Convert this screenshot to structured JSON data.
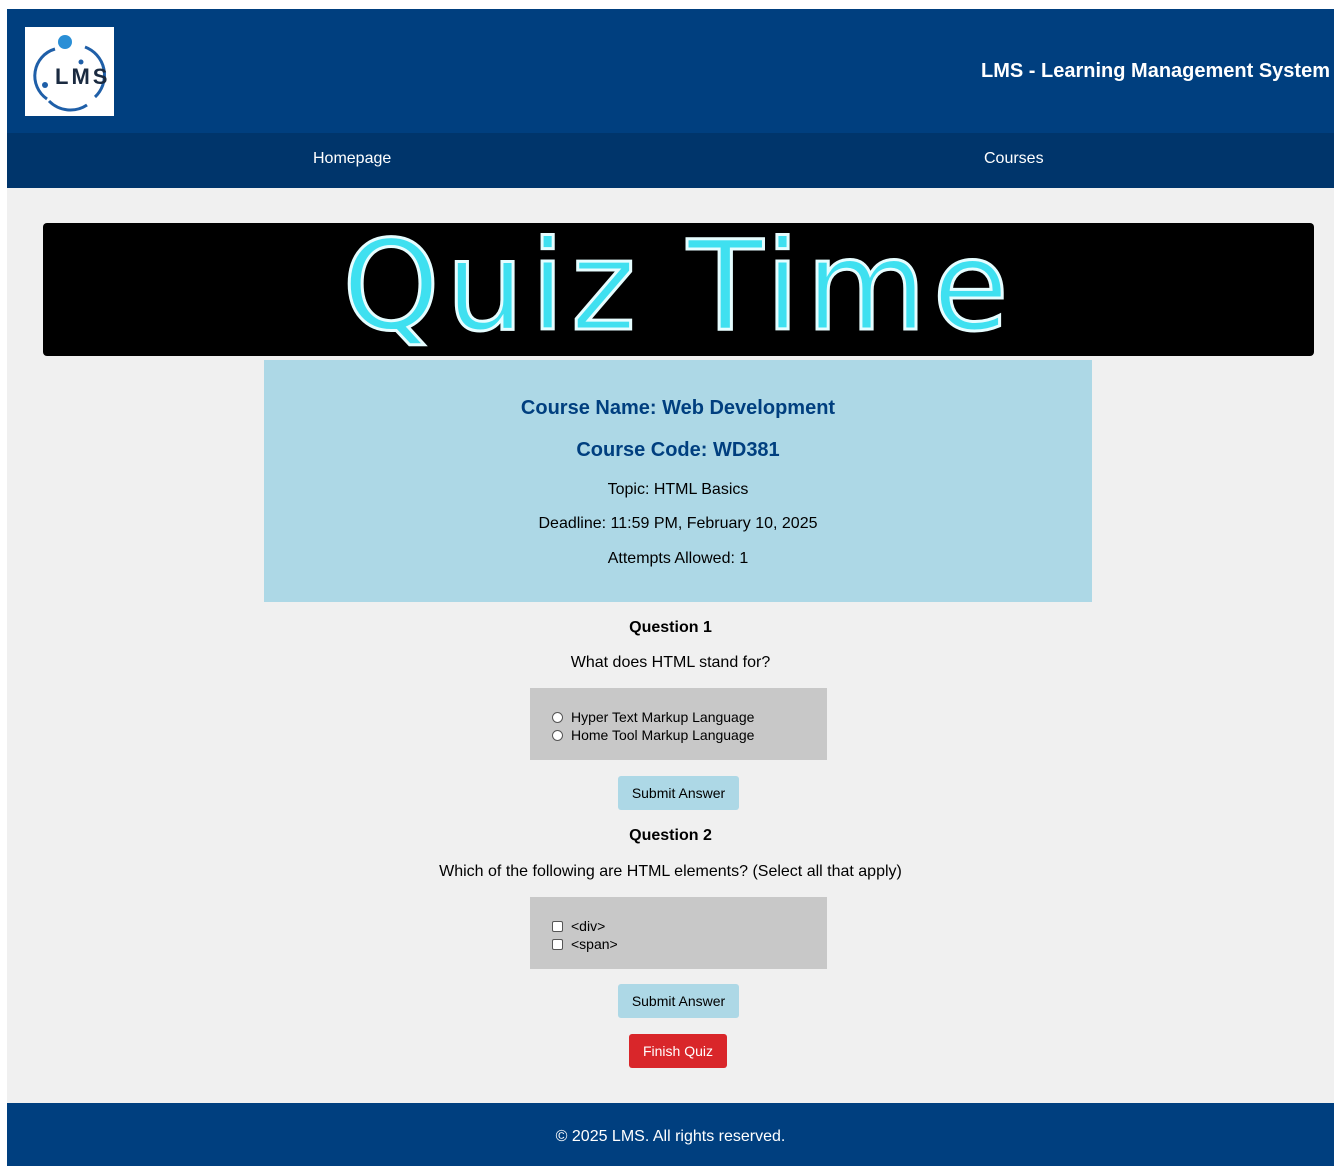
{
  "header": {
    "logo_text": "LMS",
    "title": "LMS - Learning Management System"
  },
  "nav": {
    "items": [
      {
        "label": "Homepage"
      },
      {
        "label": "Courses"
      }
    ]
  },
  "banner": {
    "text": "Quiz Time"
  },
  "course_info": {
    "name": "Course Name: Web Development",
    "code": "Course Code: WD381",
    "topic": "Topic: HTML Basics",
    "deadline": "Deadline: 11:59 PM, February 10, 2025",
    "attempts": "Attempts Allowed: 1"
  },
  "questions": [
    {
      "title": "Question 1",
      "text": "What does HTML stand for?",
      "type": "radio",
      "options": [
        "Hyper Text Markup Language",
        "Home Tool Markup Language"
      ],
      "submit_label": "Submit Answer"
    },
    {
      "title": "Question 2",
      "text": "Which of the following are HTML elements? (Select all that apply)",
      "type": "checkbox",
      "options": [
        "<div>",
        "<span>"
      ],
      "submit_label": "Submit Answer"
    }
  ],
  "finish_label": "Finish Quiz",
  "footer": {
    "text": "© 2025 LMS. All rights reserved."
  },
  "colors": {
    "header_bg": "#003f7f",
    "nav_bg": "#00356b",
    "info_bg": "#add8e6",
    "finish_button": "#d9262a"
  }
}
